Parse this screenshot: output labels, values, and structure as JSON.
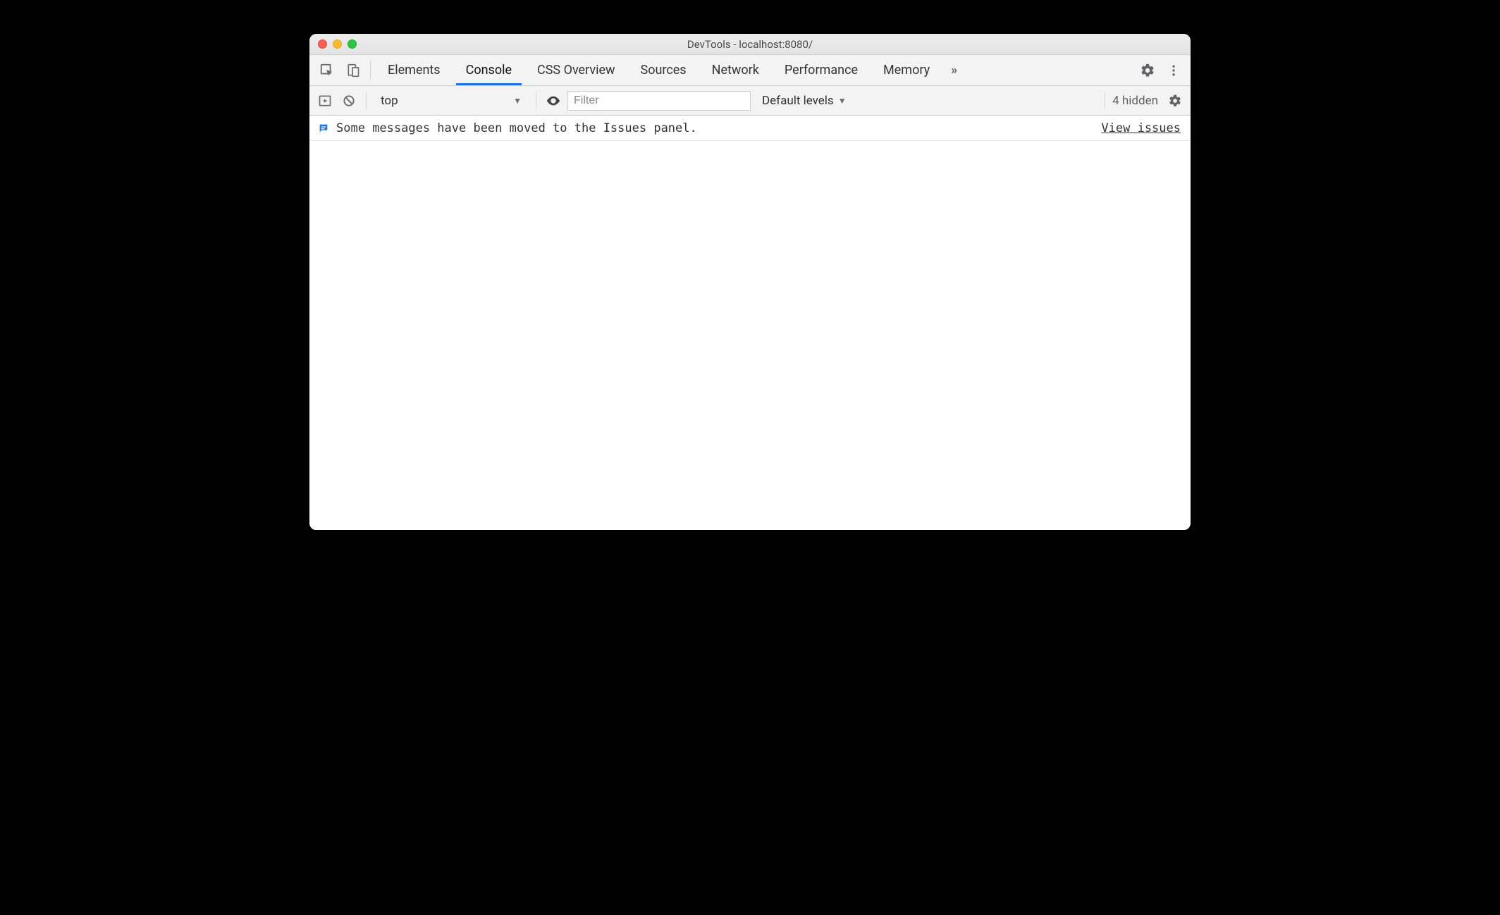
{
  "window": {
    "title": "DevTools - localhost:8080/"
  },
  "tabbar": {
    "tabs": [
      {
        "label": "Elements",
        "active": false
      },
      {
        "label": "Console",
        "active": true
      },
      {
        "label": "CSS Overview",
        "active": false
      },
      {
        "label": "Sources",
        "active": false
      },
      {
        "label": "Network",
        "active": false
      },
      {
        "label": "Performance",
        "active": false
      },
      {
        "label": "Memory",
        "active": false
      }
    ],
    "overflow_glyph": "»"
  },
  "console_toolbar": {
    "context": "top",
    "filter_placeholder": "Filter",
    "filter_value": "",
    "levels_label": "Default levels",
    "hidden_label": "4 hidden"
  },
  "messages": [
    {
      "text": "Some messages have been moved to the Issues panel.",
      "action_label": "View issues"
    }
  ]
}
